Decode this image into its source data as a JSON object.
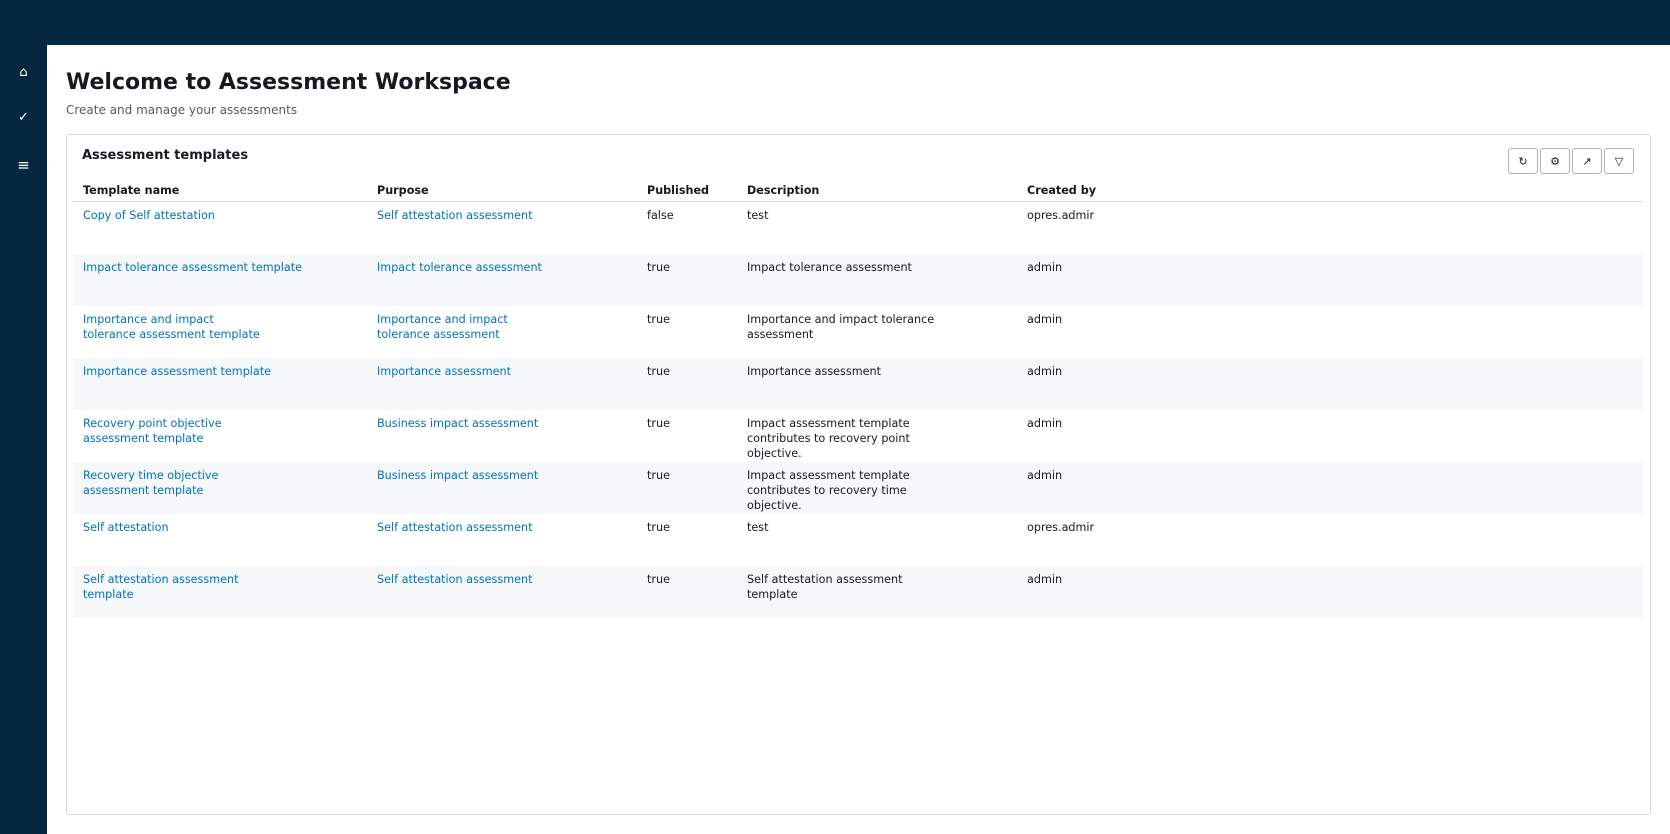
{
  "sidebar": {
    "icons": [
      {
        "name": "home-icon",
        "glyph": "⌂"
      },
      {
        "name": "check-icon",
        "glyph": "✓"
      },
      {
        "name": "menu-icon",
        "glyph": "≡"
      }
    ]
  },
  "page": {
    "title": "Welcome to Assessment Workspace",
    "subtitle": "Create and manage your assessments"
  },
  "panel": {
    "title": "Assessment templates",
    "tools": [
      {
        "name": "refresh-icon",
        "glyph": "↻"
      },
      {
        "name": "settings-icon",
        "glyph": "⚙"
      },
      {
        "name": "external-link-icon",
        "glyph": "↗"
      },
      {
        "name": "filter-icon",
        "glyph": "▽"
      }
    ]
  },
  "table": {
    "columns": [
      "Template name",
      "Purpose",
      "Published",
      "Description",
      "Created by"
    ],
    "rows": [
      {
        "name": "Copy of Self attestation",
        "purpose": "Self attestation assessment",
        "published": "false",
        "description": "test",
        "created_by": "opres.admir"
      },
      {
        "name": "Impact tolerance assessment template",
        "purpose": "Impact tolerance assessment",
        "published": "true",
        "description": "Impact tolerance assessment",
        "created_by": "admin"
      },
      {
        "name": "Importance and impact tolerance assessment template",
        "purpose": "Importance and impact tolerance assessment",
        "published": "true",
        "description": "Importance and impact tolerance assessment",
        "created_by": "admin"
      },
      {
        "name": "Importance assessment template",
        "purpose": "Importance assessment",
        "published": "true",
        "description": "Importance assessment",
        "created_by": "admin"
      },
      {
        "name": "Recovery point objective assessment template",
        "purpose": "Business impact assessment",
        "published": "true",
        "description": "Impact assessment template contributes to recovery point objective.",
        "created_by": "admin"
      },
      {
        "name": "Recovery time objective assessment template",
        "purpose": "Business impact assessment",
        "published": "true",
        "description": "Impact assessment template contributes to recovery time objective.",
        "created_by": "admin"
      },
      {
        "name": "Self attestation",
        "purpose": "Self attestation assessment",
        "published": "true",
        "description": "test",
        "created_by": "opres.admir"
      },
      {
        "name": "Self attestation assessment template",
        "purpose": "Self attestation assessment",
        "published": "true",
        "description": "Self attestation assessment template",
        "created_by": "admin"
      }
    ]
  },
  "colors": {
    "nav_bg": "#04293f",
    "link": "#0073bb",
    "text": "#16191f"
  }
}
